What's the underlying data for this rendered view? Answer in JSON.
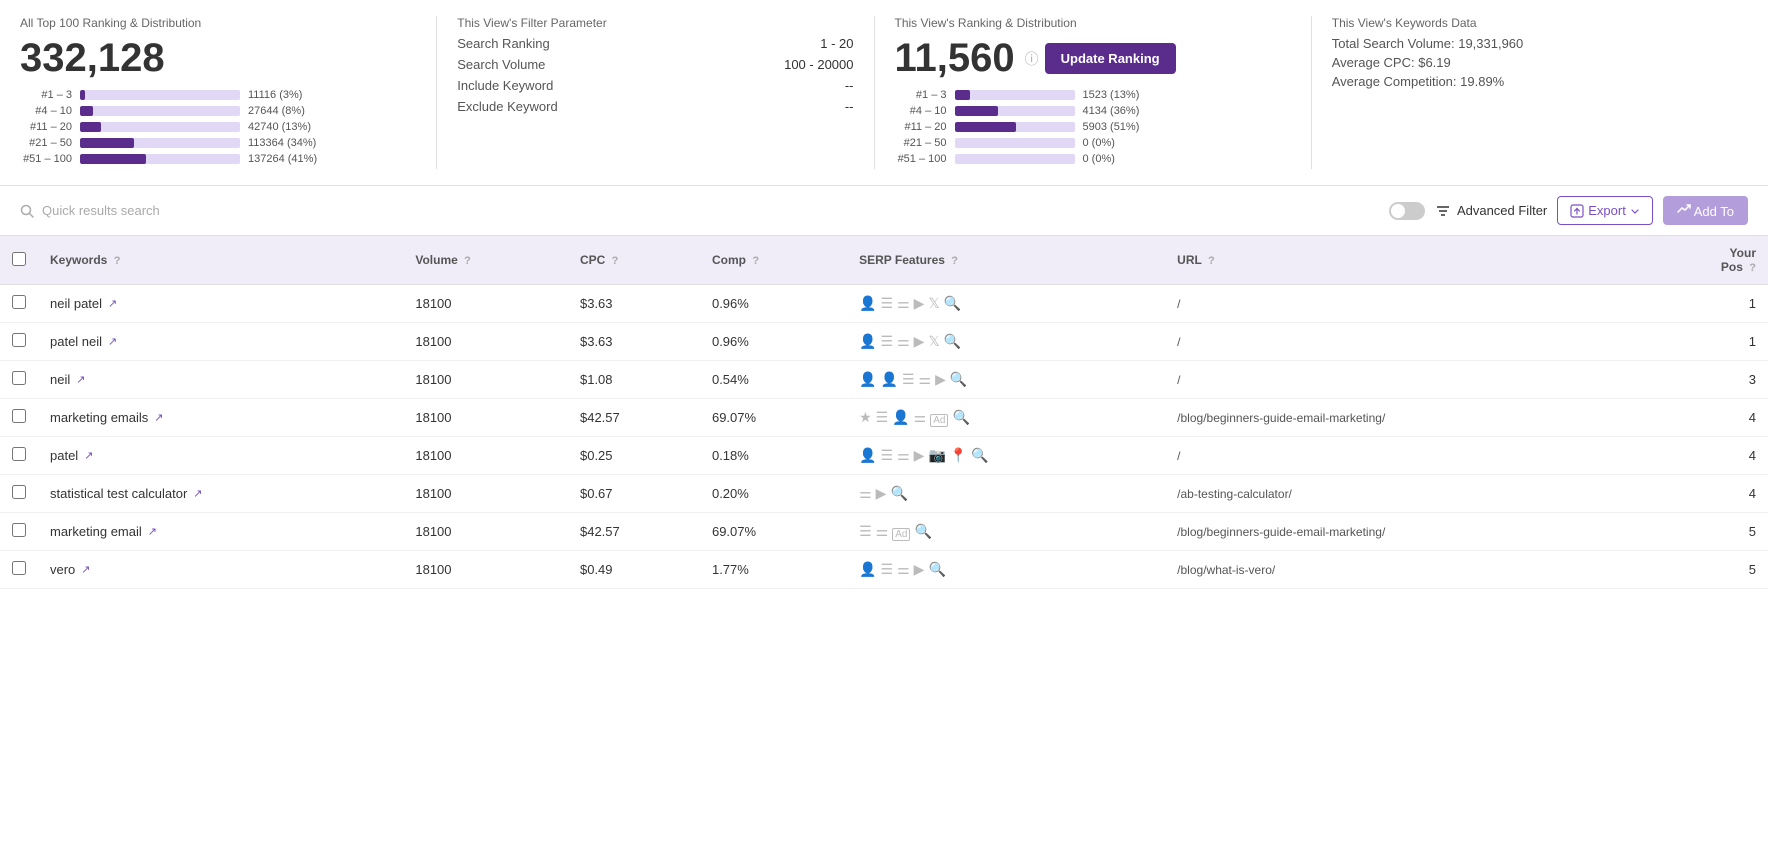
{
  "stats": {
    "allTop100": {
      "title": "All Top 100 Ranking & Distribution",
      "bigNumber": "332,128",
      "bars": [
        {
          "label": "#1 – 3",
          "darkPct": 3,
          "lightPct": 97,
          "value": "11116 (3%)"
        },
        {
          "label": "#4 – 10",
          "darkPct": 8,
          "lightPct": 92,
          "value": "27644 (8%)"
        },
        {
          "label": "#11 – 20",
          "darkPct": 13,
          "lightPct": 87,
          "value": "42740 (13%)"
        },
        {
          "label": "#21 – 50",
          "darkPct": 34,
          "lightPct": 66,
          "value": "113364 (34%)"
        },
        {
          "label": "#51 – 100",
          "darkPct": 41,
          "lightPct": 59,
          "value": "137264 (41%)"
        }
      ]
    },
    "filterParam": {
      "title": "This View's Filter Parameter",
      "rows": [
        {
          "key": "Search Ranking",
          "value": "1 - 20"
        },
        {
          "key": "Search Volume",
          "value": "100 - 20000"
        },
        {
          "key": "Include Keyword",
          "value": "--"
        },
        {
          "key": "Exclude Keyword",
          "value": "--"
        }
      ]
    },
    "viewRanking": {
      "title": "This View's Ranking & Distribution",
      "bigNumber": "11,560",
      "updateBtn": "Update Ranking",
      "bars": [
        {
          "label": "#1 – 3",
          "darkPct": 13,
          "lightPct": 87,
          "value": "1523 (13%)"
        },
        {
          "label": "#4 – 10",
          "darkPct": 36,
          "lightPct": 64,
          "value": "4134 (36%)"
        },
        {
          "label": "#11 – 20",
          "darkPct": 51,
          "lightPct": 49,
          "value": "5903 (51%)"
        },
        {
          "label": "#21 – 50",
          "darkPct": 0,
          "lightPct": 100,
          "value": "0 (0%)"
        },
        {
          "label": "#51 – 100",
          "darkPct": 0,
          "lightPct": 100,
          "value": "0 (0%)"
        }
      ]
    },
    "keywordsData": {
      "title": "This View's Keywords Data",
      "totalVolume": "Total Search Volume: 19,331,960",
      "avgCPC": "Average CPC: $6.19",
      "avgComp": "Average Competition: 19.89%"
    }
  },
  "toolbar": {
    "searchPlaceholder": "Quick results search",
    "advancedFilter": "Advanced Filter",
    "exportLabel": "Export",
    "addLabel": "Add To"
  },
  "table": {
    "headers": [
      {
        "key": "keywords",
        "label": "Keywords",
        "hasHelp": true
      },
      {
        "key": "volume",
        "label": "Volume",
        "hasHelp": true
      },
      {
        "key": "cpc",
        "label": "CPC",
        "hasHelp": true
      },
      {
        "key": "comp",
        "label": "Comp",
        "hasHelp": true
      },
      {
        "key": "serp",
        "label": "SERP Features",
        "hasHelp": true
      },
      {
        "key": "url",
        "label": "URL",
        "hasHelp": true
      },
      {
        "key": "pos",
        "label": "Your Pos",
        "hasHelp": true
      }
    ],
    "rows": [
      {
        "keyword": "neil patel",
        "volume": "18100",
        "cpc": "$3.63",
        "comp": "0.96%",
        "serp": [
          "person",
          "table",
          "shuffle",
          "play",
          "twitter",
          "search"
        ],
        "url": "/",
        "pos": "1"
      },
      {
        "keyword": "patel neil",
        "volume": "18100",
        "cpc": "$3.63",
        "comp": "0.96%",
        "serp": [
          "person",
          "table",
          "shuffle",
          "play",
          "twitter",
          "search"
        ],
        "url": "/",
        "pos": "1"
      },
      {
        "keyword": "neil",
        "volume": "18100",
        "cpc": "$1.08",
        "comp": "0.54%",
        "serp": [
          "person",
          "person2",
          "table",
          "shuffle",
          "play",
          "search"
        ],
        "url": "/",
        "pos": "3"
      },
      {
        "keyword": "marketing emails",
        "volume": "18100",
        "cpc": "$42.57",
        "comp": "69.07%",
        "serp": [
          "star",
          "table",
          "person",
          "shuffle",
          "ad",
          "search"
        ],
        "url": "/blog/beginners-guide-email-marketing/",
        "pos": "4"
      },
      {
        "keyword": "patel",
        "volume": "18100",
        "cpc": "$0.25",
        "comp": "0.18%",
        "serp": [
          "person",
          "table",
          "shuffle",
          "play",
          "image",
          "pin",
          "search"
        ],
        "url": "/",
        "pos": "4"
      },
      {
        "keyword": "statistical test calculator",
        "volume": "18100",
        "cpc": "$0.67",
        "comp": "0.20%",
        "serp": [
          "shuffle",
          "play",
          "search"
        ],
        "url": "/ab-testing-calculator/",
        "pos": "4"
      },
      {
        "keyword": "marketing email",
        "volume": "18100",
        "cpc": "$42.57",
        "comp": "69.07%",
        "serp": [
          "table",
          "shuffle",
          "ad",
          "search"
        ],
        "url": "/blog/beginners-guide-email-marketing/",
        "pos": "5"
      },
      {
        "keyword": "vero",
        "volume": "18100",
        "cpc": "$0.49",
        "comp": "1.77%",
        "serp": [
          "person",
          "table",
          "shuffle",
          "play",
          "search"
        ],
        "url": "/blog/what-is-vero/",
        "pos": "5"
      }
    ]
  }
}
